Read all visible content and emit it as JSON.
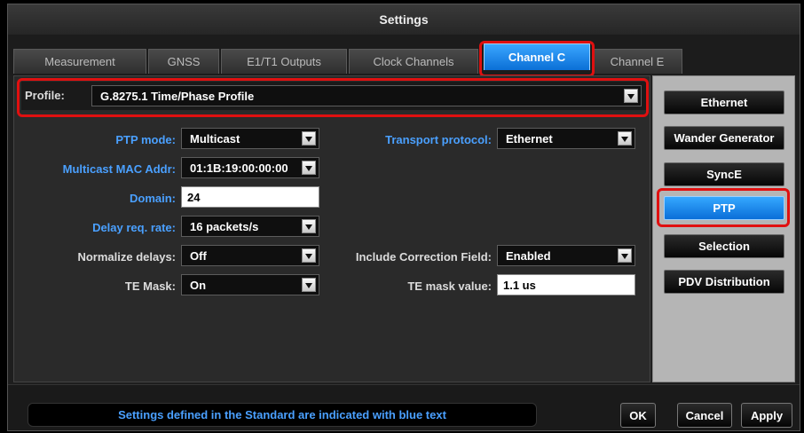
{
  "window": {
    "title": "Settings"
  },
  "tabs": [
    "Measurement",
    "GNSS",
    "E1/T1 Outputs",
    "Clock Channels",
    "Channel C",
    "Channel E"
  ],
  "active_tab": "Channel C",
  "profile": {
    "label": "Profile:",
    "value": "G.8275.1 Time/Phase Profile"
  },
  "fields": {
    "ptp_mode": {
      "label": "PTP mode:",
      "value": "Multicast"
    },
    "multicast_mac": {
      "label": "Multicast MAC Addr:",
      "value": "01:1B:19:00:00:00"
    },
    "domain": {
      "label": "Domain:",
      "value": "24"
    },
    "delay_req_rate": {
      "label": "Delay req. rate:",
      "value": "16 packets/s"
    },
    "normalize_delays": {
      "label": "Normalize delays:",
      "value": "Off"
    },
    "te_mask": {
      "label": "TE Mask:",
      "value": "On"
    },
    "transport_protocol": {
      "label": "Transport protocol:",
      "value": "Ethernet"
    },
    "include_correction": {
      "label": "Include Correction Field:",
      "value": "Enabled"
    },
    "te_mask_value": {
      "label": "TE mask value:",
      "value": "1.1 us"
    }
  },
  "side_buttons": [
    "Ethernet",
    "Wander Generator",
    "SyncE",
    "PTP",
    "Selection",
    "PDV Distribution"
  ],
  "active_side": "PTP",
  "footer": {
    "notice": "Settings defined in the Standard are indicated with blue text",
    "ok": "OK",
    "cancel": "Cancel",
    "apply": "Apply"
  },
  "colors": {
    "accent": "#1e8cf0",
    "highlight": "#e01010",
    "standard_text": "#4aa0ff"
  }
}
